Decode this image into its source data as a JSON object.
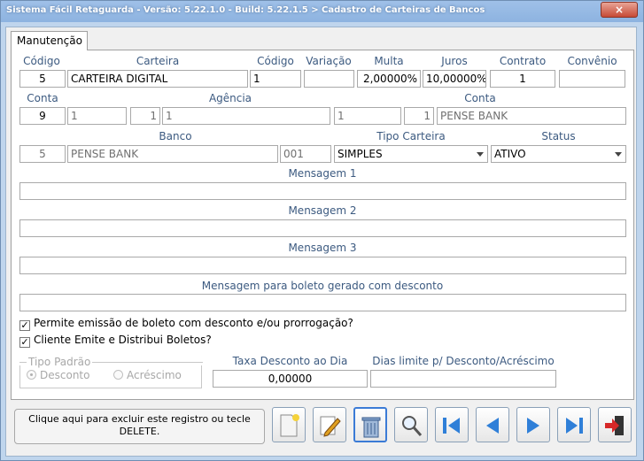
{
  "window": {
    "title": "Sistema Fácil Retaguarda - Versão: 5.22.1.0  - Build: 5.22.1.5 > Cadastro de Carteiras de Bancos",
    "close_label": "×"
  },
  "tab": {
    "label": "Manutenção"
  },
  "row1": {
    "labels": {
      "codigo": "Código",
      "carteira": "Carteira",
      "codigo2": "Código",
      "variacao": "Variação",
      "multa": "Multa",
      "juros": "Juros",
      "contrato": "Contrato",
      "convenio": "Convênio"
    },
    "values": {
      "codigo": "5",
      "carteira": "CARTEIRA DIGITAL",
      "codigo2": "1",
      "variacao": "",
      "multa": "2,00000%",
      "juros": "10,00000%",
      "contrato": "1",
      "convenio": ""
    }
  },
  "row2": {
    "labels": {
      "conta": "Conta",
      "agencia": "Agência",
      "conta2": "Conta"
    },
    "values": {
      "conta_id": "9",
      "conta_num": "1",
      "agencia_id": "1",
      "agencia_num": "1",
      "conta2_id": "1",
      "conta2_num": "1",
      "conta2_nome": "PENSE BANK"
    }
  },
  "row3": {
    "labels": {
      "banco": "Banco",
      "tipo_carteira": "Tipo Carteira",
      "status": "Status"
    },
    "values": {
      "banco_id": "5",
      "banco_nome": "PENSE BANK",
      "banco_codigo": "001",
      "tipo_carteira": "SIMPLES",
      "status": "ATIVO"
    }
  },
  "mensagens": {
    "m1_label": "Mensagem 1",
    "m2_label": "Mensagem 2",
    "m3_label": "Mensagem 3",
    "desconto_label": "Mensagem para boleto gerado com desconto",
    "m1": "",
    "m2": "",
    "m3": "",
    "desconto": ""
  },
  "checks": {
    "permite": "Permite emissão de boleto com desconto e/ou prorrogação?",
    "permite_checked": true,
    "cliente": "Cliente Emite e Distribui Boletos?",
    "cliente_checked": true
  },
  "tipo_padrao": {
    "title": "Tipo Padrão",
    "desconto": "Desconto",
    "acrescimo": "Acréscimo",
    "selected": "Desconto"
  },
  "taxa": {
    "label": "Taxa Desconto ao Dia",
    "value": "0,00000"
  },
  "dias": {
    "label": "Dias limite p/ Desconto/Acréscimo",
    "value": ""
  },
  "status_msg": "Clique aqui para excluir este registro ou tecle DELETE.",
  "toolbar": {
    "icons": [
      "new-icon",
      "edit-icon",
      "delete-icon",
      "search-icon",
      "first-icon",
      "prev-icon",
      "next-icon",
      "last-icon",
      "exit-icon"
    ]
  },
  "colors": {
    "label": "#3c5a80",
    "title_bar": "#9fc0e8",
    "accent": "#3b7bd6",
    "exit_red": "#d62828"
  }
}
